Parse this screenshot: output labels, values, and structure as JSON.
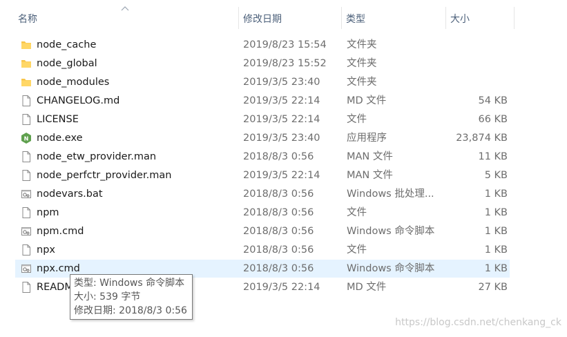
{
  "columns": {
    "name": "名称",
    "date": "修改日期",
    "type": "类型",
    "size": "大小"
  },
  "files": [
    {
      "name": "node_cache",
      "date": "2019/8/23 15:54",
      "type": "文件夹",
      "size": "",
      "icon": "folder-icon"
    },
    {
      "name": "node_global",
      "date": "2019/8/23 15:52",
      "type": "文件夹",
      "size": "",
      "icon": "folder-icon"
    },
    {
      "name": "node_modules",
      "date": "2019/3/5 23:40",
      "type": "文件夹",
      "size": "",
      "icon": "folder-icon"
    },
    {
      "name": "CHANGELOG.md",
      "date": "2019/3/5 22:14",
      "type": "MD 文件",
      "size": "54 KB",
      "icon": "file-icon"
    },
    {
      "name": "LICENSE",
      "date": "2019/3/5 22:14",
      "type": "文件",
      "size": "66 KB",
      "icon": "file-icon"
    },
    {
      "name": "node.exe",
      "date": "2019/3/5 23:40",
      "type": "应用程序",
      "size": "23,874 KB",
      "icon": "nodejs-icon"
    },
    {
      "name": "node_etw_provider.man",
      "date": "2018/8/3 0:56",
      "type": "MAN 文件",
      "size": "11 KB",
      "icon": "file-icon"
    },
    {
      "name": "node_perfctr_provider.man",
      "date": "2019/3/5 22:14",
      "type": "MAN 文件",
      "size": "5 KB",
      "icon": "file-icon"
    },
    {
      "name": "nodevars.bat",
      "date": "2018/8/3 0:56",
      "type": "Windows 批处理...",
      "size": "1 KB",
      "icon": "batch-file-icon"
    },
    {
      "name": "npm",
      "date": "2018/8/3 0:56",
      "type": "文件",
      "size": "1 KB",
      "icon": "file-icon"
    },
    {
      "name": "npm.cmd",
      "date": "2018/8/3 0:56",
      "type": "Windows 命令脚本",
      "size": "1 KB",
      "icon": "batch-file-icon"
    },
    {
      "name": "npx",
      "date": "2018/8/3 0:56",
      "type": "文件",
      "size": "1 KB",
      "icon": "file-icon"
    },
    {
      "name": "npx.cmd",
      "date": "2018/8/3 0:56",
      "type": "Windows 命令脚本",
      "size": "1 KB",
      "icon": "batch-file-icon",
      "hover": true
    },
    {
      "name": "README.md",
      "date": "2019/3/5 22:14",
      "type": "MD 文件",
      "size": "27 KB",
      "icon": "file-icon"
    }
  ],
  "tooltip": {
    "line1": "类型: Windows 命令脚本",
    "line2": "大小: 539 字节",
    "line3": "修改日期: 2018/8/3 0:56"
  },
  "watermark": "https://blog.csdn.net/chenkang_ck",
  "colors": {
    "folder": "#f8c54a",
    "hover": "#e5f3ff",
    "header_text": "#4c607a",
    "node_green": "#5fa04e"
  }
}
